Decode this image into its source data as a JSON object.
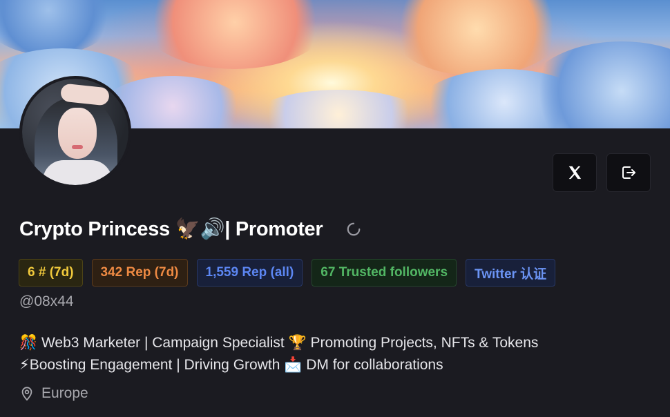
{
  "profile": {
    "display_name": "Crypto Princess 🦅🔊| Promoter",
    "handle": "@08x44",
    "bio_line1": "🎊 Web3 Marketer | Campaign Specialist 🏆 Promoting Projects, NFTs & Tokens",
    "bio_line2": "⚡Boosting Engagement | Driving Growth 📩 DM for collaborations",
    "location": "Europe"
  },
  "badges": {
    "rank": "6 # (7d)",
    "rep_7d": "342 Rep (7d)",
    "rep_all": "1,559 Rep (all)",
    "trusted_followers": "67 Trusted followers",
    "twitter_verified": "Twitter 认证"
  },
  "actions": {
    "x_icon": "x-logo-icon",
    "logout_icon": "logout-icon"
  },
  "colors": {
    "background": "#1b1b21",
    "rank": "#f0c93c",
    "rep_7d": "#ee8a43",
    "rep_all": "#5c86f2",
    "trusted": "#52b664",
    "twitter": "#6b94f4"
  }
}
